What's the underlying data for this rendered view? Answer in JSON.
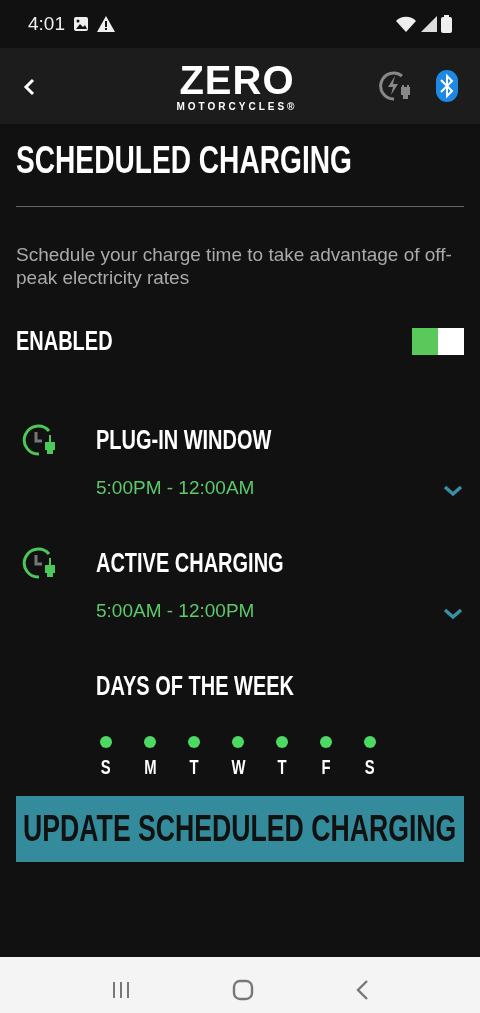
{
  "status_bar": {
    "time": "4:01"
  },
  "app_bar": {
    "logo_title": "ZERO",
    "logo_subtitle": "MOTORCYCLES®"
  },
  "title": "SCHEDULED CHARGING",
  "description": "Schedule your charge time to take advantage of off-peak electricity rates",
  "enabled": {
    "label": "ENABLED",
    "on": true
  },
  "windows": [
    {
      "label": "PLUG-IN WINDOW",
      "time": "5:00PM - 12:00AM",
      "expanded": false
    },
    {
      "label": "ACTIVE CHARGING",
      "time": "5:00AM - 12:00PM",
      "expanded": false
    }
  ],
  "days_title": "DAYS OF THE WEEK",
  "days": [
    {
      "label": "S",
      "selected": true
    },
    {
      "label": "M",
      "selected": true
    },
    {
      "label": "T",
      "selected": true
    },
    {
      "label": "W",
      "selected": true
    },
    {
      "label": "T",
      "selected": true
    },
    {
      "label": "F",
      "selected": true
    },
    {
      "label": "S",
      "selected": true
    }
  ],
  "update_button": "UPDATE SCHEDULED CHARGING"
}
